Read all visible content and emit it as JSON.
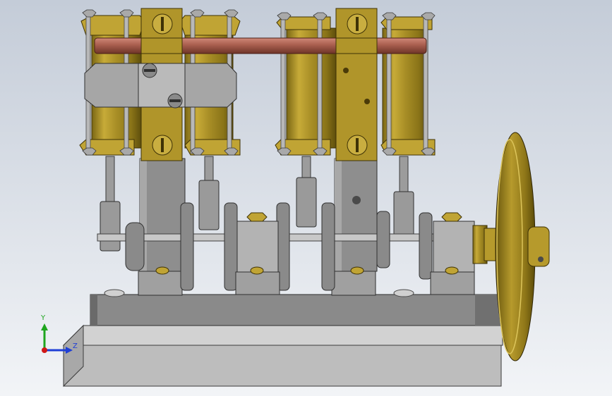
{
  "viewport": {
    "background_top": "#c4ccd8",
    "background_bottom": "#f2f4f7"
  },
  "model": {
    "component_names": [
      "base-plate",
      "engine-bed",
      "cylinder-1",
      "cylinder-2",
      "cylinder-3",
      "cylinder-4",
      "column-left",
      "column-right",
      "valve-rod",
      "crankshaft",
      "main-bearing",
      "flywheel"
    ],
    "colors": {
      "brass": "#b79a2c",
      "brass_dark": "#6e5c10",
      "brass_light": "#dcc45a",
      "steel": "#9c9c9c",
      "steel_dark": "#6e6e6e",
      "steel_light": "#c8c8c8",
      "copper": "#b06858",
      "base": "#bdbdbd"
    }
  },
  "triad": {
    "y_label": "Y",
    "z_label": "Z",
    "y_color": "#1ea51e",
    "z_color": "#1f3fd6",
    "x_color": "#d01818"
  }
}
